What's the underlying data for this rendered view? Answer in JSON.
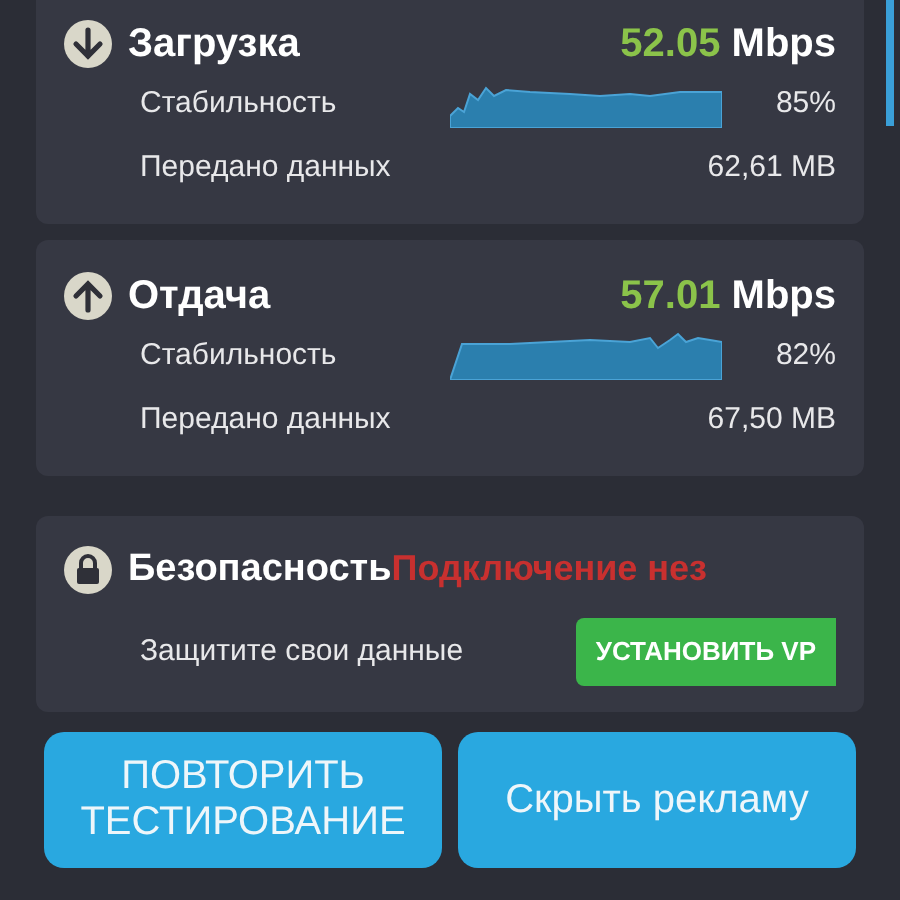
{
  "speed_cards": [
    {
      "kind": "download",
      "title": "Загрузка",
      "speed": "52.05",
      "unit": "Mbps",
      "stability_label": "Стабильность",
      "stability": "85%",
      "data_label": "Передано данных",
      "data": "62,61 MB"
    },
    {
      "kind": "upload",
      "title": "Отдача",
      "speed": "57.01",
      "unit": "Mbps",
      "stability_label": "Стабильность",
      "stability": "82%",
      "data_label": "Передано данных",
      "data": "67,50 MB"
    }
  ],
  "security": {
    "title": "Безопасность",
    "status": "Подключение нез",
    "hint": "Защитите свои данные",
    "button": "УСТАНОВИТЬ VP"
  },
  "buttons": [
    "ПОВТОРИТЬ ТЕСТИРОВАНИЕ",
    "Скрыть рекламу"
  ]
}
